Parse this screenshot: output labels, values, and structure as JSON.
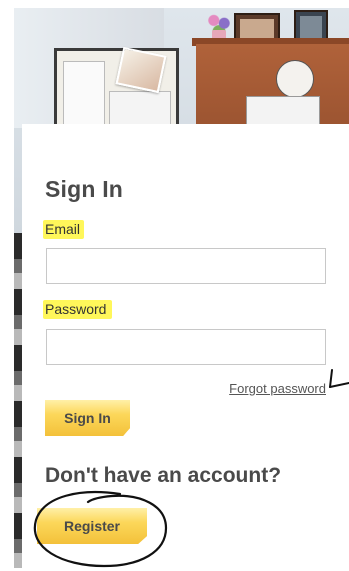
{
  "signin": {
    "title": "Sign In",
    "email_label": "Email",
    "email_value": "",
    "password_label": "Password",
    "password_value": "",
    "forgot_link": "Forgot password",
    "signin_button": "Sign In"
  },
  "register": {
    "heading": "Don't have an account?",
    "register_button": "Register"
  },
  "annotations": {
    "highlight_color": "#fff75a",
    "ink_color": "#111111",
    "items": [
      "highlight-email-label",
      "highlight-password-label",
      "arrow-to-forgot-password",
      "circle-around-register"
    ]
  },
  "colors": {
    "button_gradient_top": "#fff0a8",
    "button_gradient_bottom": "#f3c13a",
    "text_dark": "#4a4a4a"
  }
}
